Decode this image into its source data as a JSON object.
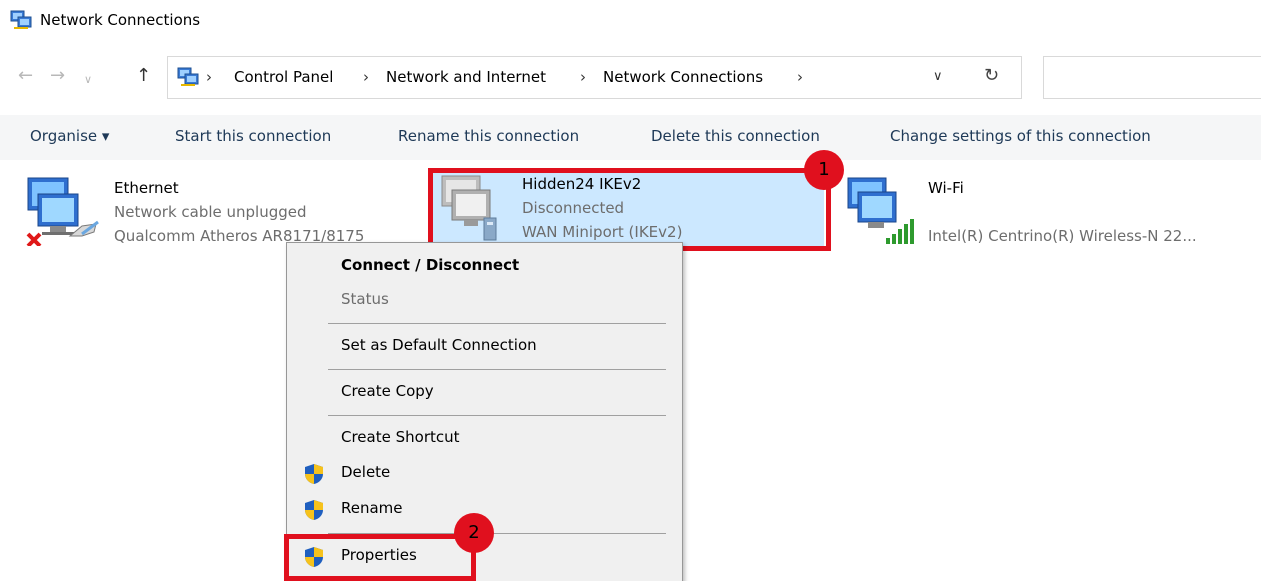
{
  "window": {
    "title": "Network Connections"
  },
  "navigation": {
    "back_icon": "back-arrow-icon",
    "forward_icon": "forward-arrow-icon",
    "recent_icon": "chevron-down-icon",
    "up_icon": "up-arrow-icon",
    "breadcrumbs": [
      "Control Panel",
      "Network and Internet",
      "Network Connections"
    ],
    "search_placeholder": ""
  },
  "toolbar": {
    "organise_label": "Organise ▾",
    "start_label": "Start this connection",
    "rename_label": "Rename this connection",
    "delete_label": "Delete this connection",
    "change_label": "Change settings of this connection"
  },
  "connections": [
    {
      "name": "Ethernet",
      "status": "Network cable unplugged",
      "device": "Qualcomm Atheros AR8171/8175",
      "icon": "ethernet-disconnected-icon"
    },
    {
      "name": "Hidden24 IKEv2",
      "status": "Disconnected",
      "device": "WAN Miniport (IKEv2)",
      "icon": "vpn-connection-icon",
      "selected": true
    },
    {
      "name": "Wi-Fi",
      "status": "",
      "device": "Intel(R) Centrino(R) Wireless-N 22...",
      "icon": "wifi-signal-icon"
    }
  ],
  "context_menu": {
    "connect": "Connect / Disconnect",
    "status": "Status",
    "set_default": "Set as Default Connection",
    "create_copy": "Create Copy",
    "create_shortcut": "Create Shortcut",
    "delete": "Delete",
    "rename": "Rename",
    "properties": "Properties"
  },
  "annotations": {
    "step1": "1",
    "step2": "2"
  },
  "colors": {
    "highlight": "#e0101e",
    "selection": "#cce8ff",
    "toolbar_text": "#1e3957"
  }
}
